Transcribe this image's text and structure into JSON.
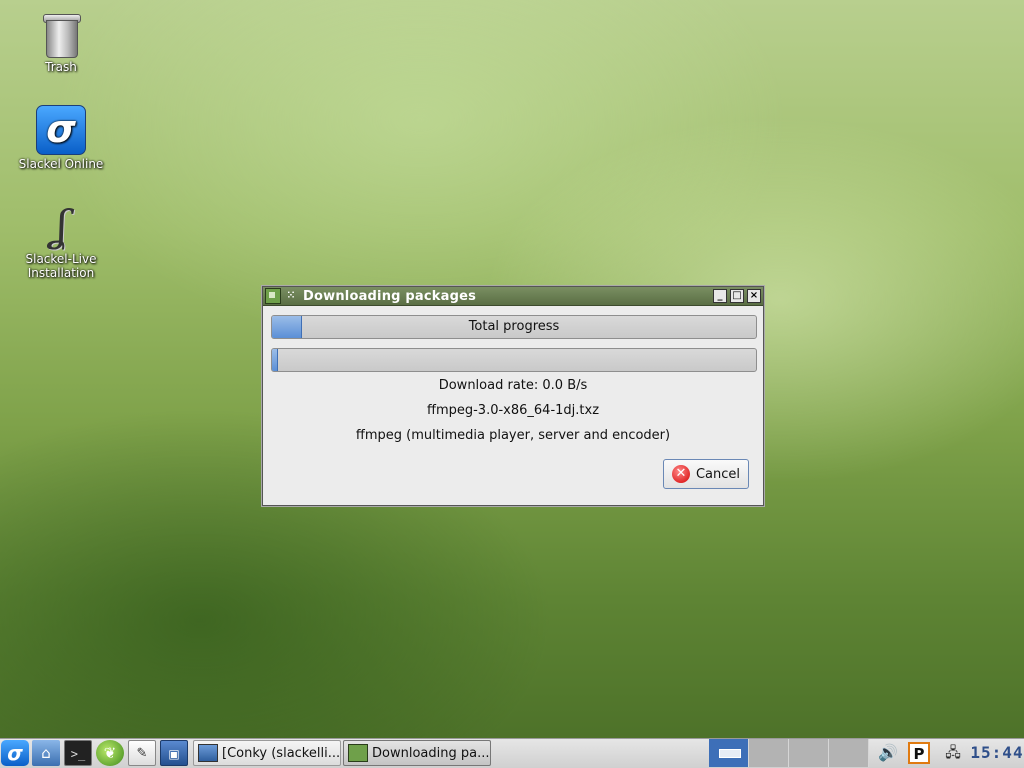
{
  "desktop": {
    "icons": [
      {
        "label": "Trash",
        "icon": "trash-icon"
      },
      {
        "label": "Slackel Online",
        "icon": "slackel-online-icon"
      },
      {
        "label": "Slackel-Live Installation",
        "icon": "slackel-live-icon"
      }
    ]
  },
  "dialog": {
    "title": "Downloading packages",
    "total_progress_label": "Total progress",
    "total_progress": 0.06,
    "file_progress": 0.01,
    "download_rate": "Download rate: 0.0 B/s",
    "file_name": "ffmpeg-3.0-x86_64-1dj.txz",
    "description": "ffmpeg (multimedia player, server and encoder)",
    "cancel_label": "Cancel",
    "window_buttons": {
      "minimize": "_",
      "maximize": "□",
      "close": "×"
    }
  },
  "taskbar": {
    "menu_glyph": "σ",
    "launchers": [
      "home-icon",
      "terminal-icon",
      "leaf-icon",
      "text-editor-icon",
      "show-desktop-icon"
    ],
    "launcher_glyphs": {
      "home": "⌂",
      "terminal": ">_",
      "leaf": "❦",
      "editor": "✎",
      "desktop": "▣"
    },
    "tasks": [
      {
        "label": "[Conky (slackelli...",
        "icon": "window-icon"
      },
      {
        "label": "Downloading pa...",
        "icon": "package-icon"
      }
    ],
    "pager": {
      "desktops": 4,
      "active": 1
    },
    "tray": {
      "volume_glyph": "🔊",
      "pkg_label": "P",
      "network_glyph": "🖧"
    },
    "clock": "15:44"
  },
  "colors": {
    "accent": "#3d6fb8",
    "titlebar": "#6a7f52",
    "progress_fill": "#5b8fd6"
  }
}
